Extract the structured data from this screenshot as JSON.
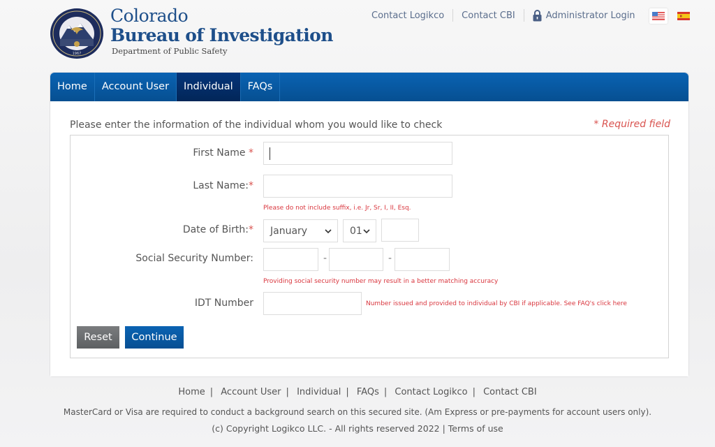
{
  "header": {
    "brand_line1": "Colorado",
    "brand_line2": "Bureau of Investigation",
    "brand_line3": "Department of Public Safety",
    "seal_year": "1967",
    "top_links": {
      "contact_logikco": "Contact Logikco",
      "contact_cbi": "Contact CBI",
      "admin_login": "Administrator Login"
    },
    "languages": [
      {
        "code": "en",
        "icon": "us-flag-icon",
        "active": true
      },
      {
        "code": "es",
        "icon": "spain-flag-icon",
        "active": false
      }
    ]
  },
  "nav": {
    "items": [
      {
        "label": "Home",
        "active": false
      },
      {
        "label": "Account User",
        "active": false
      },
      {
        "label": "Individual",
        "active": true
      },
      {
        "label": "FAQs",
        "active": false
      }
    ]
  },
  "form": {
    "intro": "Please enter the information of the individual whom you would like to check",
    "required_note": "* Required field",
    "first_name": {
      "label": "First Name ",
      "required_mark": "*",
      "value": ""
    },
    "last_name": {
      "label": "Last Name:",
      "required_mark": "*",
      "value": "",
      "hint": "Please do not include suffix, i.e. Jr, Sr, I, II, Esq."
    },
    "dob": {
      "label": "Date of Birth:",
      "required_mark": "*",
      "month": "January",
      "day": "01",
      "year": ""
    },
    "ssn": {
      "label": "Social Security Number:",
      "part1": "",
      "part2": "",
      "part3": "",
      "separator": "-",
      "hint": "Providing social security number may result in a better matching accuracy"
    },
    "idt": {
      "label": "IDT Number",
      "value": "",
      "hint": "Number issued and provided to individual by CBI if applicable. See FAQ's click here"
    },
    "reset_label": "Reset",
    "continue_label": "Continue"
  },
  "footer": {
    "links": [
      "Home",
      "Account User",
      "Individual",
      "FAQs",
      "Contact Logikco",
      "Contact CBI"
    ],
    "separator": "|",
    "note": "MasterCard or Visa are required to conduct a background search on this secured site. (Am Express or pre-payments for account users only).",
    "copyright": "(c) Copyright Logikco LLC. - All rights reserved 2022 | ",
    "terms": "Terms of use"
  },
  "colors": {
    "brand_blue": "#1e4f8a",
    "nav_blue": "#0a63b3",
    "nav_active": "#022658",
    "required_red": "#d9534f"
  }
}
